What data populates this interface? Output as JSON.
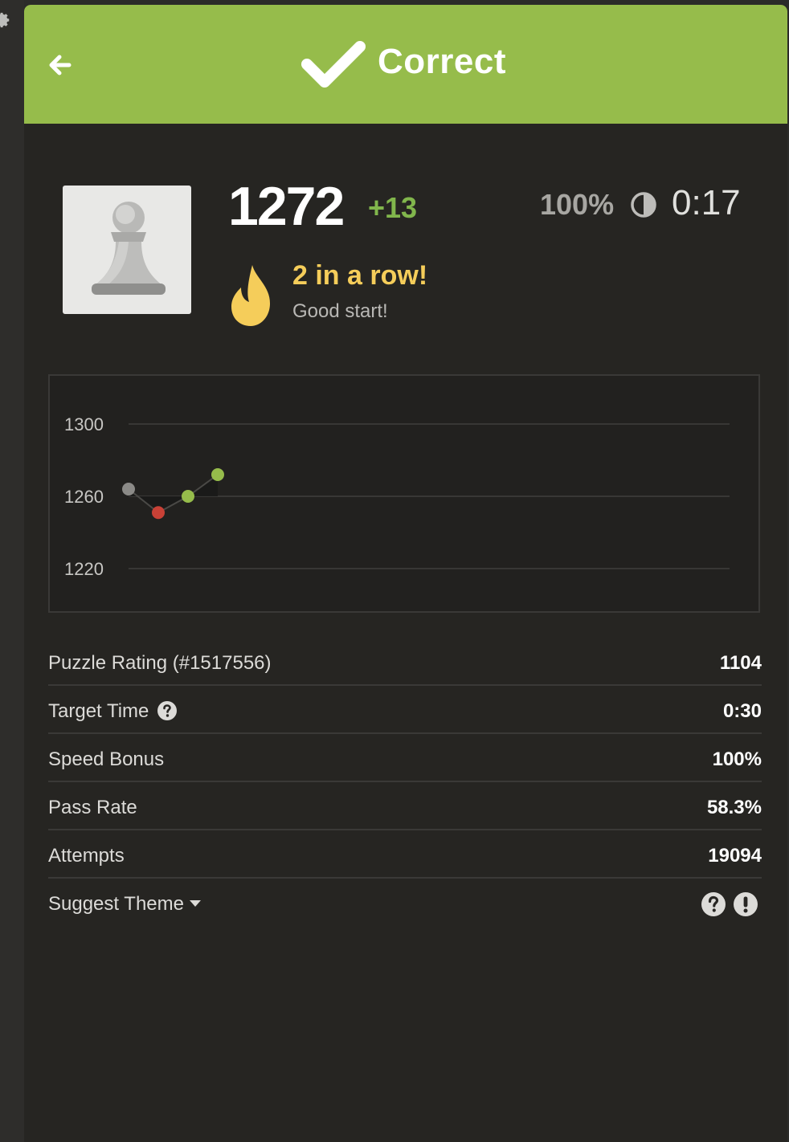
{
  "header": {
    "status_label": "Correct",
    "color": "#96bc4b"
  },
  "player": {
    "rating": "1272",
    "rating_delta": "+13",
    "accuracy": "100%",
    "time": "0:17"
  },
  "streak": {
    "title": "2 in a row!",
    "subtitle": "Good start!"
  },
  "chart_data": {
    "type": "line",
    "y_ticks": [
      "1300",
      "1260",
      "1220"
    ],
    "ylim": [
      1210,
      1310
    ],
    "x": [
      1,
      2,
      3,
      4
    ],
    "values": [
      1264,
      1251,
      1260,
      1272
    ],
    "point_colors": [
      "#8b8a87",
      "#c94136",
      "#96bc4b",
      "#96bc4b"
    ],
    "grid": true
  },
  "stats": [
    {
      "label": "Puzzle Rating (#1517556)",
      "value": "1104"
    },
    {
      "label": "Target Time",
      "value": "0:30"
    },
    {
      "label": "Speed Bonus",
      "value": "100%"
    },
    {
      "label": "Pass Rate",
      "value": "58.3%"
    },
    {
      "label": "Attempts",
      "value": "19094"
    }
  ],
  "suggest_theme": {
    "label": "Suggest Theme"
  },
  "icons": {
    "back": "arrow-left-icon",
    "check": "checkmark-icon",
    "contrast": "half-circle-icon",
    "fire": "fire-icon",
    "help": "question-circle-icon",
    "report": "exclamation-circle-icon",
    "settings": "gear-icon"
  }
}
